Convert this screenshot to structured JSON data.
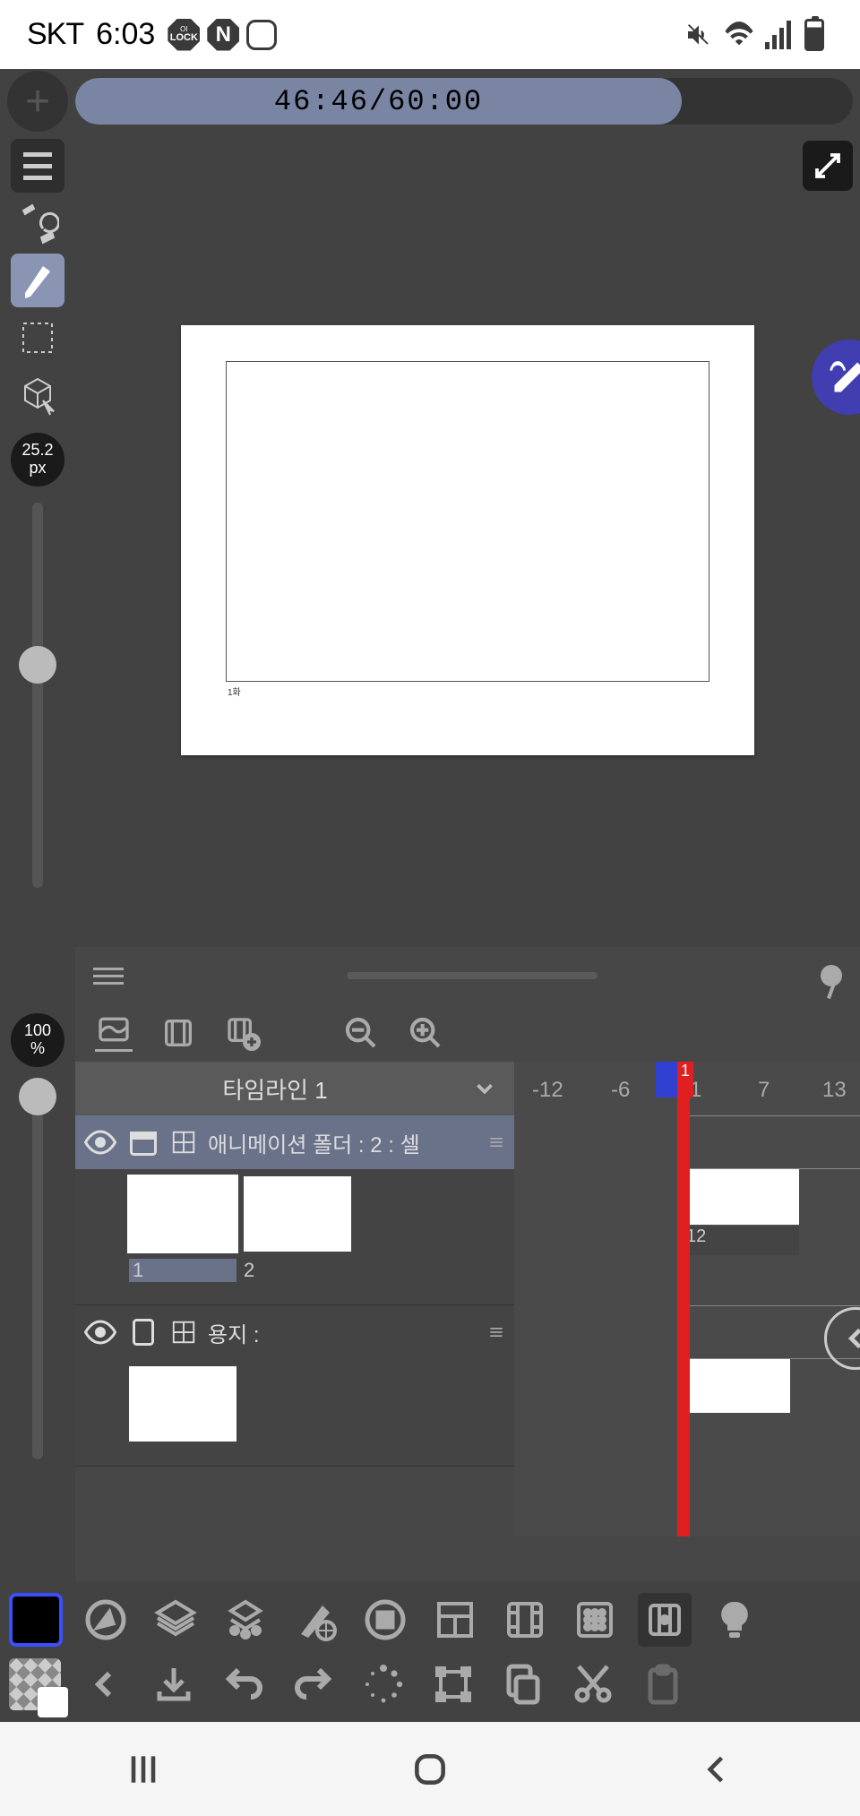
{
  "statusbar": {
    "carrier": "SKT",
    "time": "6:03"
  },
  "timer": {
    "display": "46:46/60:00"
  },
  "brush": {
    "size": "25.2",
    "unit": "px"
  },
  "opacity": {
    "value": "100",
    "unit": "%"
  },
  "canvas": {
    "label": "1화"
  },
  "timeline": {
    "selected": "타임라인 1",
    "ruler": [
      "-12",
      "-6",
      "1",
      "7",
      "13",
      "1"
    ],
    "tracks": [
      {
        "visible": true,
        "name": "애니메이션 폴더 : 2 : 셀",
        "cells": [
          "1",
          "2"
        ],
        "selected_cell": "1",
        "clip_label": "12"
      },
      {
        "visible": true,
        "name": "용지 :",
        "cells": [
          "paper"
        ]
      }
    ]
  }
}
